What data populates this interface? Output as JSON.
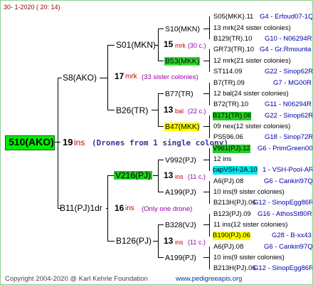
{
  "header": {
    "date": "30-   1-2020  ( 20:  14)"
  },
  "root": {
    "label": "510(AKO)",
    "num": "19",
    "ins": "ins",
    "remark": "(Drones from 1 single colony)"
  },
  "gen1": [
    {
      "label": "S8(AKO)",
      "num": "17",
      "mark": "mrk",
      "note": "(33 sister colonies)"
    },
    {
      "label": "B11(PJ)1dr",
      "num": "16",
      "mark": "ins",
      "note": "(Only one drone)"
    }
  ],
  "gen2": [
    {
      "label": "S01(MKN)",
      "num": "15",
      "mark": "mrk",
      "note": "(30 c.)"
    },
    {
      "label": "B26(TR)",
      "num": "13",
      "mark": "bal",
      "note": "(22 c.)"
    },
    {
      "label": "V216(PJ)",
      "num": "13",
      "mark": "ins",
      "note": "(11 c.)"
    },
    {
      "label": "B126(PJ)",
      "num": "13",
      "mark": "ins",
      "note": "(11 c.)"
    }
  ],
  "gen3": [
    {
      "label": "S10(MKN)",
      "num": "13",
      "mark": "mrk",
      "note": "(24 c.)"
    },
    {
      "label": "B53(MKK)",
      "num": "12",
      "mark": "mrk",
      "note": "(21 c.)"
    },
    {
      "label": "B77(TR)",
      "num": "12",
      "mark": "bal",
      "note": "(24 c.)"
    },
    {
      "label": "B47(MKK)",
      "num": "09",
      "mark": "nex",
      "note": "(12 c.)"
    },
    {
      "label": "V992(PJ)",
      "num": "12",
      "mark": "ins",
      "note": ""
    },
    {
      "label": "A199(PJ)",
      "num": "10",
      "mark": "ins",
      "note": "(9 c.)"
    },
    {
      "label": "B328(VJ)",
      "num": "11",
      "mark": "ins",
      "note": "(12 c.)"
    },
    {
      "label": "A199(PJ)",
      "num": "10",
      "mark": "ins",
      "note": "(9 c.)"
    }
  ],
  "gen4": [
    {
      "a": "S05(MKK).11",
      "b": "G4 - Erfoud07-1Q"
    },
    {
      "a": "13 mrk(24 sister colonies)",
      "b": ""
    },
    {
      "a": "B129(TR).10",
      "b": "G10 - N06294R"
    },
    {
      "a": "GR73(TR).10",
      "b": "G4 - Gr.Rmounta"
    },
    {
      "a": "12 mrk(21 sister colonies)",
      "b": ""
    },
    {
      "a": "ST114.09",
      "b": "G22 - Sinop62R"
    },
    {
      "a": "B7(TR).09",
      "b": "G7 - MG00R"
    },
    {
      "a": "12 bal(24 sister colonies)",
      "b": ""
    },
    {
      "a": "B72(TR).10",
      "b": "G11 - N06294R"
    },
    {
      "a": "B171(TR).06",
      "b": "G22 - Sinop62R"
    },
    {
      "a": "09 nex(12 sister colonies)",
      "b": ""
    },
    {
      "a": "PS596.06",
      "b": "G18 - Sinop72R"
    },
    {
      "a": "V961(PJ).12",
      "b": "G6 - PrimGreen00"
    },
    {
      "a": "12 ins",
      "b": ""
    },
    {
      "a": "capVSH-2A.10",
      "b": "1 - VSH-Pool-AR"
    },
    {
      "a": "A6(PJ).08",
      "b": "G6 - Cankiri97Q"
    },
    {
      "a": "10 ins(9 sister colonies)",
      "b": ""
    },
    {
      "a": "B213H(PJ).06",
      "b": "G12 - SinopEgg86R"
    },
    {
      "a": "B123(PJ).09",
      "b": "G16 - AthosSt80R"
    },
    {
      "a": "11 ins(12 sister colonies)",
      "b": ""
    },
    {
      "a": "B190(PJ).06",
      "b": "G28 - B-xx43"
    },
    {
      "a": "A6(PJ).08",
      "b": "G6 - Cankiri97Q"
    },
    {
      "a": "10 ins(9 sister colonies)",
      "b": ""
    },
    {
      "a": "B213H(PJ).06",
      "b": "G12 - SinopEgg86R"
    }
  ],
  "footer": {
    "copyright": "Copyright 2004-2020 @ Karl Kehrle Foundation",
    "url": "www.pedigreeapis.org"
  }
}
